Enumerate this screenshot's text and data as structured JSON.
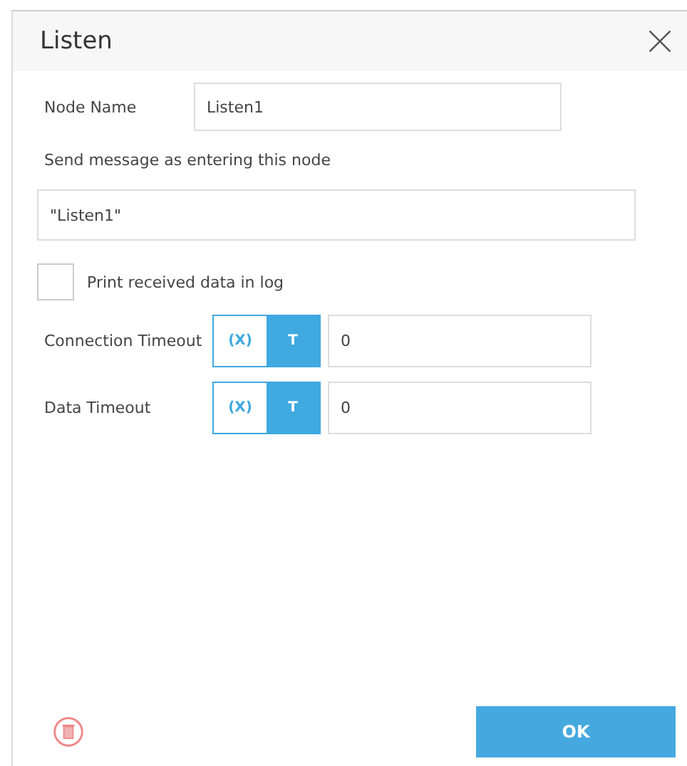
{
  "window": {
    "title": "Listen"
  },
  "node_name": {
    "label": "Node Name",
    "value": "Listen1"
  },
  "message": {
    "label": "Send message as entering this node",
    "value": "\"Listen1\""
  },
  "print_log": {
    "label": "Print received data in log",
    "checked": false
  },
  "timeouts": [
    {
      "label": "Connection Timeout",
      "modes": [
        {
          "label": "(X)",
          "selected": false
        },
        {
          "label": "T",
          "selected": true
        }
      ],
      "value": "0"
    },
    {
      "label": "Data Timeout",
      "modes": [
        {
          "label": "(X)",
          "selected": false
        },
        {
          "label": "T",
          "selected": true
        }
      ],
      "value": "0"
    }
  ],
  "ok_button": "OK"
}
